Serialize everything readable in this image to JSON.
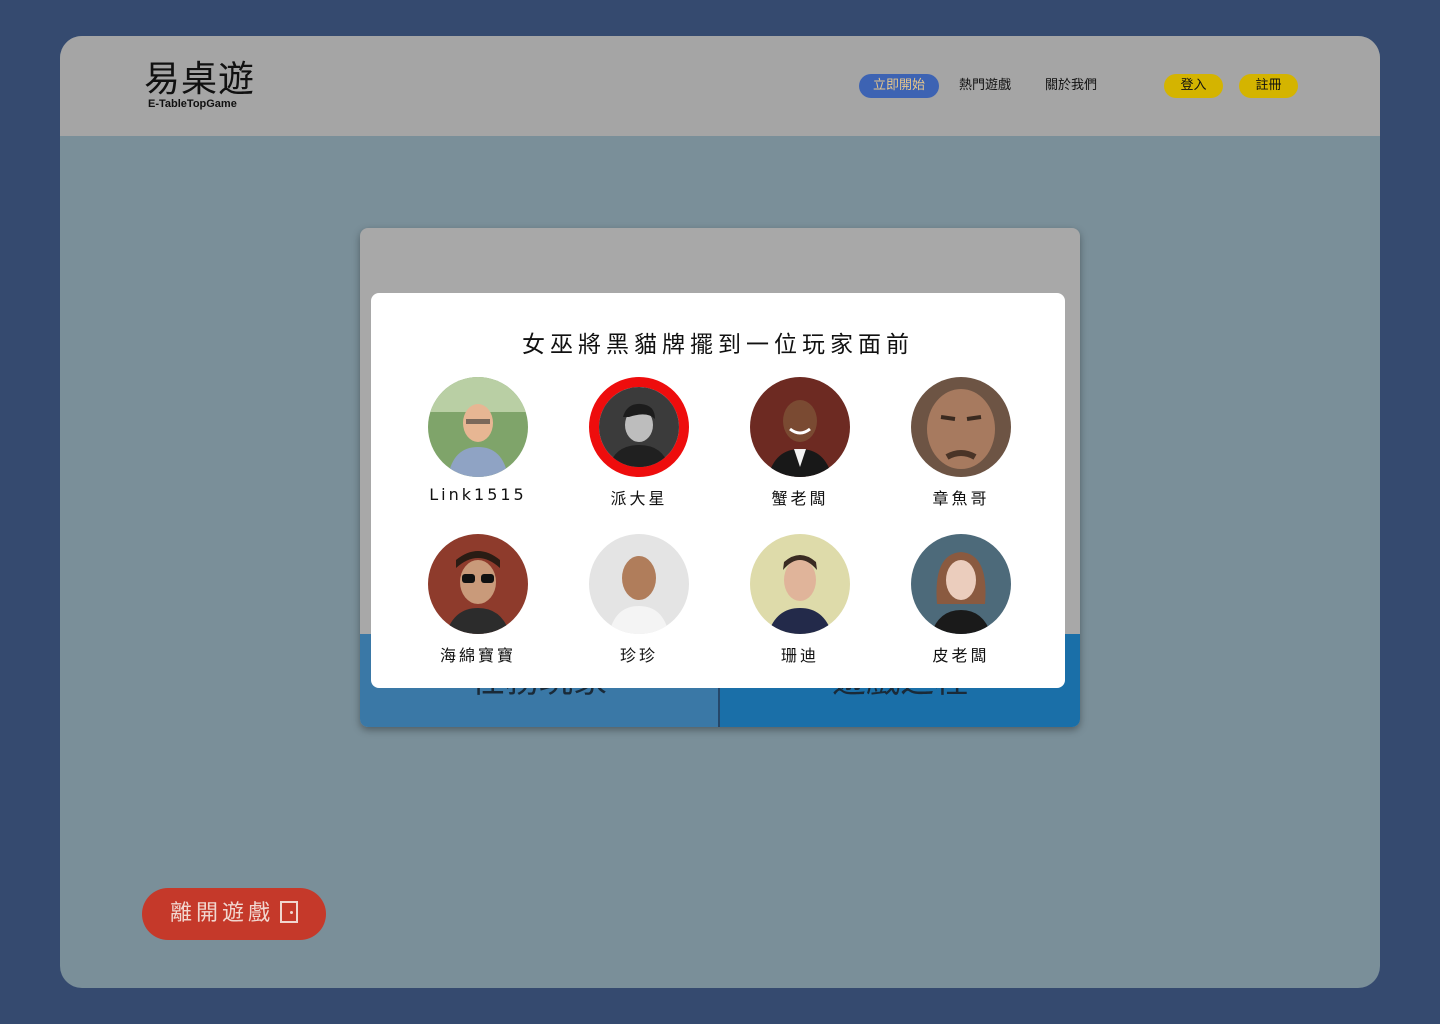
{
  "header": {
    "logo_main": "易桌遊",
    "logo_sub": "E-TableTopGame",
    "nav": {
      "start": "立即開始",
      "hot": "熱門遊戲",
      "about": "關於我們",
      "login": "登入",
      "register": "註冊"
    }
  },
  "board": {
    "tab_left": "任務玩家",
    "tab_right": "遊戲進程"
  },
  "modal": {
    "title": "女巫將黑貓牌擺到一位玩家面前",
    "players": [
      {
        "name": "Link1515",
        "selected": false
      },
      {
        "name": "派大星",
        "selected": true
      },
      {
        "name": "蟹老闆",
        "selected": false
      },
      {
        "name": "章魚哥",
        "selected": false
      },
      {
        "name": "海綿寶寶",
        "selected": false
      },
      {
        "name": "珍珍",
        "selected": false
      },
      {
        "name": "珊迪",
        "selected": false
      },
      {
        "name": "皮老闆",
        "selected": false
      }
    ]
  },
  "leave_button": "離開遊戲",
  "colors": {
    "background": "#354a6f",
    "selected_ring": "#ee0d0d",
    "leave_button": "#c5392a",
    "nav_accent": "#d4b400"
  }
}
